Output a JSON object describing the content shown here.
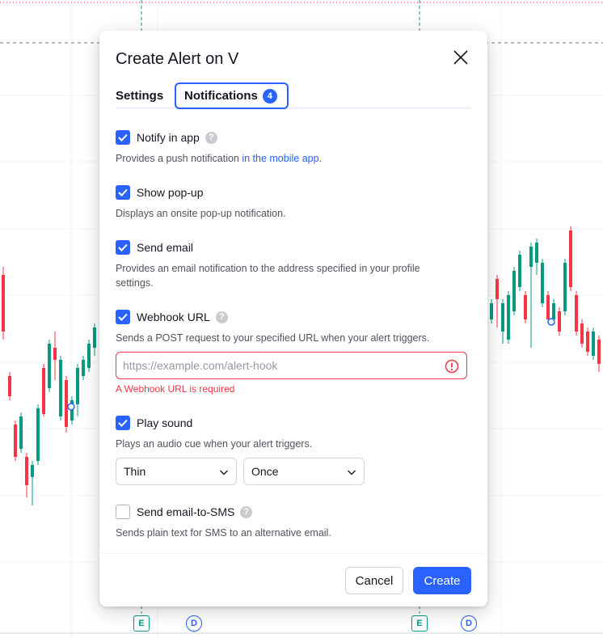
{
  "dialog": {
    "title": "Create Alert on V",
    "tabs": [
      {
        "label": "Settings"
      },
      {
        "label": "Notifications",
        "badge": "4"
      }
    ],
    "options": [
      {
        "label": "Notify in app",
        "checked": true,
        "has_help": true,
        "description_prefix": "Provides a push notification ",
        "description_link": "in the mobile app",
        "description_suffix": "."
      },
      {
        "label": "Show pop-up",
        "checked": true,
        "description": "Displays an onsite pop-up notification."
      },
      {
        "label": "Send email",
        "checked": true,
        "description": "Provides an email notification to the address specified in your profile settings."
      },
      {
        "label": "Webhook URL",
        "checked": true,
        "has_help": true,
        "description": "Sends a POST request to your specified URL when your alert triggers."
      },
      {
        "label": "Play sound",
        "checked": true,
        "description": "Plays an audio cue when your alert triggers."
      },
      {
        "label": "Send email-to-SMS",
        "checked": false,
        "has_help": true,
        "description": "Sends plain text for SMS to an alternative email."
      }
    ],
    "webhook": {
      "placeholder": "https://example.com/alert-hook",
      "value": "",
      "error": "A Webhook URL is required"
    },
    "sound": {
      "tone": "Thin",
      "repeat": "Once"
    },
    "buttons": {
      "cancel": "Cancel",
      "create": "Create"
    }
  },
  "chart_markers": {
    "earnings": "E",
    "dividend": "D"
  },
  "colors": {
    "accent": "#2962ff",
    "error": "#f23645",
    "candle_up": "#089981",
    "candle_down": "#f23645"
  }
}
